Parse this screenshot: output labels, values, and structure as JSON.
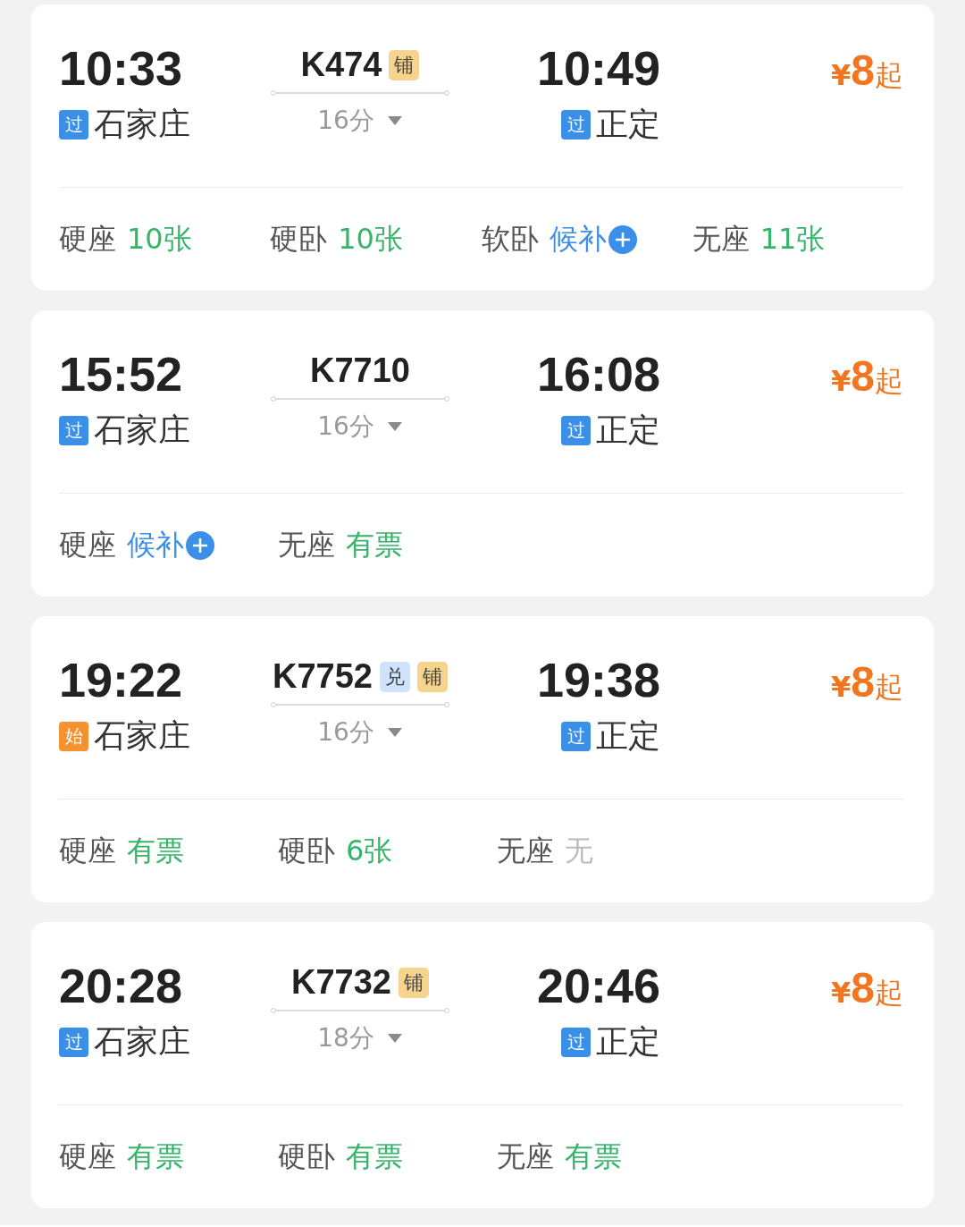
{
  "trains": [
    {
      "depart_time": "10:33",
      "depart_station": {
        "tag": "过",
        "kind": "pass",
        "name": "石家庄"
      },
      "train_no": "K474",
      "train_tags": [
        {
          "text": "铺",
          "kind": "berth"
        }
      ],
      "duration": "16分",
      "arrive_time": "10:49",
      "arrive_station": {
        "tag": "过",
        "kind": "pass",
        "name": "正定"
      },
      "price_symbol": "¥",
      "price": "8",
      "price_suffix": "起",
      "seats": [
        {
          "type": "硬座",
          "status": "10张",
          "kind": "available"
        },
        {
          "type": "硬卧",
          "status": "10张",
          "kind": "available"
        },
        {
          "type": "软卧",
          "status": "候补",
          "kind": "waitlist"
        },
        {
          "type": "无座",
          "status": "11张",
          "kind": "available"
        }
      ]
    },
    {
      "depart_time": "15:52",
      "depart_station": {
        "tag": "过",
        "kind": "pass",
        "name": "石家庄"
      },
      "train_no": "K7710",
      "duration": "16分",
      "arrive_time": "16:08",
      "arrive_station": {
        "tag": "过",
        "kind": "pass",
        "name": "正定"
      },
      "price_symbol": "¥",
      "price": "8",
      "price_suffix": "起",
      "seats": [
        {
          "type": "硬座",
          "status": "候补",
          "kind": "waitlist"
        },
        {
          "type": "无座",
          "status": "有票",
          "kind": "available"
        }
      ]
    },
    {
      "depart_time": "19:22",
      "depart_station": {
        "tag": "始",
        "kind": "start",
        "name": "石家庄"
      },
      "train_no": "K7752",
      "train_tags": [
        {
          "text": "兑",
          "kind": "exchange"
        },
        {
          "text": "铺",
          "kind": "berth"
        }
      ],
      "duration": "16分",
      "arrive_time": "19:38",
      "arrive_station": {
        "tag": "过",
        "kind": "pass",
        "name": "正定"
      },
      "price_symbol": "¥",
      "price": "8",
      "price_suffix": "起",
      "seats": [
        {
          "type": "硬座",
          "status": "有票",
          "kind": "available"
        },
        {
          "type": "硬卧",
          "status": "6张",
          "kind": "available"
        },
        {
          "type": "无座",
          "status": "无",
          "kind": "soldout"
        }
      ]
    },
    {
      "depart_time": "20:28",
      "depart_station": {
        "tag": "过",
        "kind": "pass",
        "name": "石家庄"
      },
      "train_no": "K7732",
      "train_tags": [
        {
          "text": "铺",
          "kind": "berth"
        }
      ],
      "duration": "18分",
      "arrive_time": "20:46",
      "arrive_station": {
        "tag": "过",
        "kind": "pass",
        "name": "正定"
      },
      "price_symbol": "¥",
      "price": "8",
      "price_suffix": "起",
      "seats": [
        {
          "type": "硬座",
          "status": "有票",
          "kind": "available"
        },
        {
          "type": "硬卧",
          "status": "有票",
          "kind": "available"
        },
        {
          "type": "无座",
          "status": "有票",
          "kind": "available"
        }
      ]
    }
  ]
}
